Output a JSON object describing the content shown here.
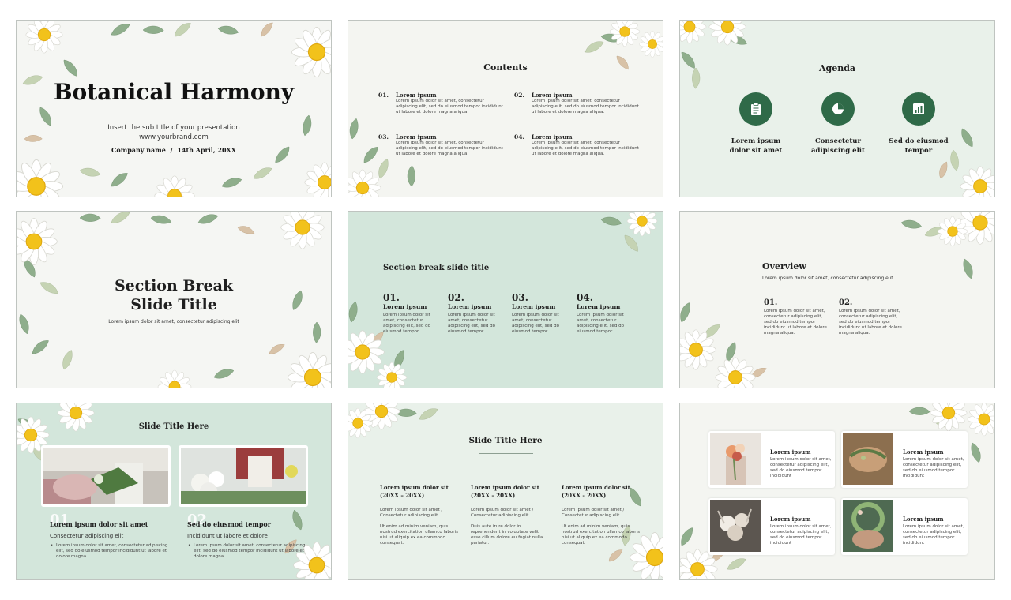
{
  "slide1": {
    "title": "Botanical Harmony",
    "subtitle": "Insert the sub title of your presentation",
    "url": "www.yourbrand.com",
    "company": "Company name",
    "separator": "/",
    "date": "14th April, 20XX"
  },
  "slide2": {
    "title": "Contents",
    "items": [
      {
        "num": "01.",
        "head": "Lorem ipsum",
        "text": "Lorem ipsum dolor sit amet, consectetur adipiscing elit, sed do eiusmod tempor incididunt ut labore et dolore magna aliqua."
      },
      {
        "num": "02.",
        "head": "Lorem ipsum",
        "text": "Lorem ipsum dolor sit amet, consectetur adipiscing elit, sed do eiusmod tempor incididunt ut labore et dolore magna aliqua."
      },
      {
        "num": "03.",
        "head": "Lorem ipsum",
        "text": "Lorem ipsum dolor sit amet, consectetur adipiscing elit, sed do eiusmod tempor incididunt ut labore et dolore magna aliqua."
      },
      {
        "num": "04.",
        "head": "Lorem ipsum",
        "text": "Lorem ipsum dolor sit amet, consectetur adipiscing elit, sed do eiusmod tempor incididunt ut labore et dolore magna aliqua."
      }
    ]
  },
  "slide3": {
    "title": "Agenda",
    "items": [
      {
        "line1": "Lorem ipsum",
        "line2": "dolor sit amet",
        "icon": "clipboard-icon"
      },
      {
        "line1": "Consectetur",
        "line2": "adipiscing elit",
        "icon": "pie-chart-icon"
      },
      {
        "line1": "Sed do eiusmod",
        "line2": "tempor",
        "icon": "bar-chart-icon"
      }
    ]
  },
  "slide4": {
    "title_line1": "Section Break",
    "title_line2": "Slide Title",
    "subtitle": "Lorem ipsum dolor sit amet, consectetur adipiscing elit"
  },
  "slide5": {
    "title": "Section break slide title",
    "items": [
      {
        "num": "01.",
        "head": "Lorem ipsum",
        "text": "Lorem ipsum dolor sit amet, consectetur adipiscing elit, sed do eiusmod tempor"
      },
      {
        "num": "02.",
        "head": "Lorem ipsum",
        "text": "Lorem ipsum dolor sit amet, consectetur adipiscing elit, sed do eiusmod tempor"
      },
      {
        "num": "03.",
        "head": "Lorem ipsum",
        "text": "Lorem ipsum dolor sit amet, consectetur adipiscing elit, sed do eiusmod tempor"
      },
      {
        "num": "04.",
        "head": "Lorem ipsum",
        "text": "Lorem ipsum dolor sit amet, consectetur adipiscing elit, sed do eiusmod tempor"
      }
    ]
  },
  "slide6": {
    "title": "Overview",
    "subtitle": "Lorem ipsum dolor sit amet, consectetur adipiscing elit",
    "items": [
      {
        "num": "01.",
        "text": "Lorem ipsum dolor sit amet, consectetur adipiscing elit, sed do eiusmod tempor incididunt ut labore et dolore magna aliqua."
      },
      {
        "num": "02.",
        "text": "Lorem ipsum dolor sit amet, consectetur adipiscing elit, sed do eiusmod tempor incididunt ut labore et dolore magna aliqua."
      }
    ]
  },
  "slide7": {
    "title": "Slide Title Here",
    "cols": [
      {
        "num": "01",
        "head": "Lorem ipsum dolor sit amet",
        "sub": "Consectetur adipiscing elit",
        "bullet": "Lorem ipsum dolor sit amet, consectetur adipiscing elit, sed do eiusmod tempor incididunt ut labore et dolore magna"
      },
      {
        "num": "02",
        "head": "Sed do eiusmod tempor",
        "sub": "Incididunt ut labore et dolore",
        "bullet": "Lorem ipsum dolor sit amet, consectetur adipiscing elit, sed do eiusmod tempor incididunt ut labore et dolore magna"
      }
    ]
  },
  "slide8": {
    "title": "Slide Title Here",
    "cols": [
      {
        "head": "Lorem ipsum dolor sit (20XX – 20XX)",
        "sub": "Lorem ipsum dolor sit amet / Consectetur adipiscing elit",
        "text": "Ut enim ad minim veniam, quis nostrud exercitation ullamco laboris nisi ut aliquip ex ea commodo consequat."
      },
      {
        "head": "Lorem ipsum dolor sit (20XX – 20XX)",
        "sub": "Lorem ipsum dolor sit amet / Consectetur adipiscing elit",
        "text": "Duis aute irure dolor in reprehenderit in voluptate velit esse cillum dolore eu fugiat nulla pariatur."
      },
      {
        "head": "Lorem ipsum dolor sit (20XX – 20XX)",
        "sub": "Lorem ipsum dolor sit amet / Consectetur adipiscing elit",
        "text": "Ut enim ad minim veniam, quis nostrud exercitation ullamco laboris nisi ut aliquip ex ea commodo consequat."
      }
    ]
  },
  "slide9": {
    "cards": [
      {
        "head": "Lorem ipsum",
        "text": "Lorem ipsum dolor sit amet, consectetur adipiscing elit, sed do eiusmod tempor incididunt"
      },
      {
        "head": "Lorem ipsum",
        "text": "Lorem ipsum dolor sit amet, consectetur adipiscing elit, sed do eiusmod tempor incididunt"
      },
      {
        "head": "Lorem ipsum",
        "text": "Lorem ipsum dolor sit amet, consectetur adipiscing elit, sed do eiusmod tempor incididunt"
      },
      {
        "head": "Lorem ipsum",
        "text": "Lorem ipsum dolor sit amet, consectetur adipiscing elit, sed do eiusmod tempor incididunt"
      }
    ]
  },
  "colors": {
    "accent": "#2f6a48",
    "leaf": "#8fae8c",
    "mint": "#d3e6db",
    "petal": "#ffffff",
    "flower_center": "#f2c21b"
  }
}
